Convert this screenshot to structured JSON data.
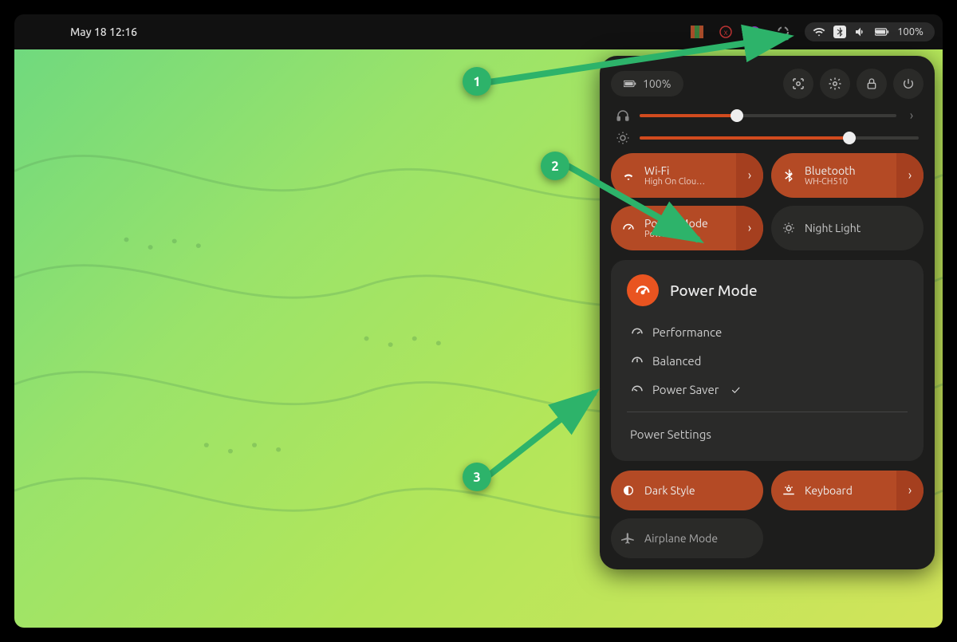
{
  "topbar": {
    "datetime": "May 18  12:16",
    "status": {
      "battery_text": "100%"
    }
  },
  "panel": {
    "battery_chip": "100%",
    "sliders": {
      "volume": {
        "value": 38,
        "track_bg": "#3a3a38",
        "fill": "#d14b1e"
      },
      "brightness": {
        "value": 75,
        "track_bg": "#3a3a38",
        "fill": "#d14b1e"
      }
    },
    "toggles": {
      "wifi": {
        "title": "Wi-Fi",
        "sub": "High On Clou…",
        "active": true,
        "has_sub": true,
        "has_arrow": true
      },
      "bluetooth": {
        "title": "Bluetooth",
        "sub": "WH-CH510",
        "active": true,
        "has_sub": true,
        "has_arrow": true
      },
      "powermode": {
        "title": "Power Mode",
        "sub": "Power Saver",
        "active": true,
        "has_sub": true,
        "has_arrow": true
      },
      "nightlight": {
        "title": "Night Light",
        "sub": "",
        "active": false,
        "has_sub": false,
        "has_arrow": false
      },
      "darkstyle": {
        "title": "Dark Style",
        "sub": "",
        "active": true,
        "has_sub": false,
        "has_arrow": false
      },
      "keyboard": {
        "title": "Keyboard",
        "sub": "",
        "active": true,
        "has_sub": false,
        "has_arrow": true
      },
      "airplane": {
        "title": "Airplane Mode",
        "sub": "",
        "active": false,
        "has_sub": false,
        "has_arrow": false
      }
    },
    "submenu": {
      "title": "Power Mode",
      "options": [
        {
          "label": "Performance",
          "selected": false
        },
        {
          "label": "Balanced",
          "selected": false
        },
        {
          "label": "Power Saver",
          "selected": true
        }
      ],
      "footer_link": "Power Settings"
    }
  },
  "annotations": {
    "1": "1",
    "2": "2",
    "3": "3"
  },
  "colors": {
    "accent": "#e95420",
    "accent_dark": "#b44a25",
    "panel_bg": "#1d1d1c"
  }
}
